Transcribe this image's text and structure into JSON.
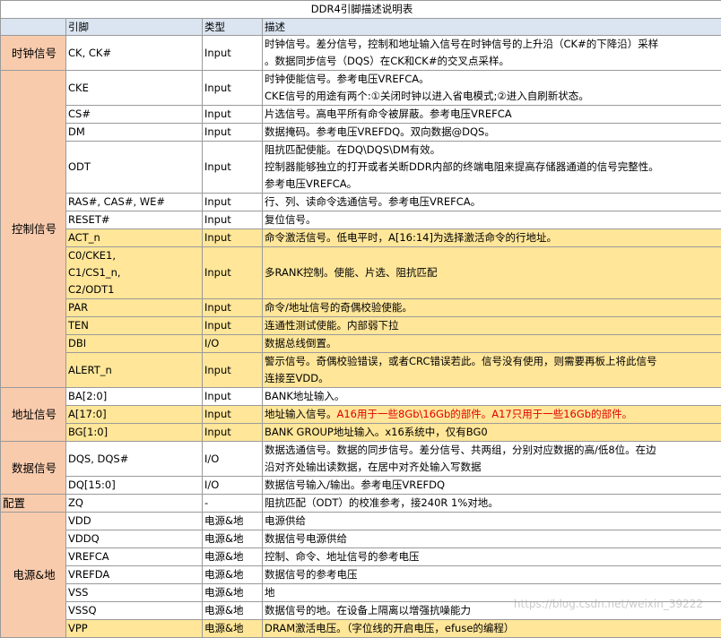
{
  "title": "DDR4引脚描述说明表",
  "headers": [
    "",
    "引脚",
    "类型",
    "描述"
  ],
  "groups": {
    "clock": "时钟信号",
    "control": "控制信号",
    "address": "地址信号",
    "data": "数据信号",
    "config": "配置",
    "power": "电源&地"
  },
  "rows": [
    {
      "pin": "CK, CK#",
      "type": "Input",
      "desc": [
        "时钟信号。差分信号，控制和地址输入信号在时钟信号的上升沿（CK#的下降沿）采样",
        "。数据同步信号（DQS）在CK和CK#的交叉点采样。"
      ]
    },
    {
      "pin": "CKE",
      "type": "Input",
      "desc": [
        "时钟使能信号。参考电压VREFCA。",
        "CKE信号的用途有两个:①关闭时钟以进入省电模式;②进入自刷新状态。"
      ]
    },
    {
      "pin": "CS#",
      "type": "Input",
      "desc": [
        "片选信号。高电平所有命令被屏蔽。参考电压VREFCA"
      ]
    },
    {
      "pin": "DM",
      "type": "Input",
      "desc": [
        "数据掩码。参考电压VREFDQ。双向数据@DQS。"
      ]
    },
    {
      "pin": "ODT",
      "type": "Input",
      "desc": [
        "阻抗匹配使能。在DQ\\DQS\\DM有效。",
        "控制器能够独立的打开或者关断DDR内部的终端电阻来提高存储器通道的信号完整性。",
        "参考电压VREFCA。"
      ]
    },
    {
      "pin": "RAS#, CAS#, WE#",
      "type": "Input",
      "desc": [
        "行、列、读命令选通信号。参考电压VREFCA。"
      ]
    },
    {
      "pin": "RESET#",
      "type": "Input",
      "desc": [
        "复位信号。"
      ]
    },
    {
      "pin": "ACT_n",
      "type": "Input",
      "desc": [
        "命令激活信号。低电平时，A[16:14]为选择激活命令的行地址。"
      ]
    },
    {
      "pin": [
        "C0/CKE1,",
        "C1/CS1_n,",
        "C2/ODT1"
      ],
      "type": "Input",
      "desc": [
        "多RANK控制。使能、片选、阻抗匹配"
      ]
    },
    {
      "pin": "PAR",
      "type": "Input",
      "desc": [
        "命令/地址信号的奇偶校验使能。"
      ]
    },
    {
      "pin": "TEN",
      "type": "Input",
      "desc": [
        "连通性测试使能。内部弱下拉"
      ]
    },
    {
      "pin": "DBI",
      "type": "I/O",
      "desc": [
        "数据总线倒置。"
      ]
    },
    {
      "pin": "ALERT_n",
      "type": "Input",
      "desc": [
        "警示信号。奇偶校验错误，或者CRC错误若此。信号没有使用，则需要再板上将此信号",
        "连接至VDD。"
      ]
    },
    {
      "pin": "BA[2:0]",
      "type": "Input",
      "desc": [
        "BANK地址输入。"
      ]
    },
    {
      "pin": "A[17:0]",
      "type": "Input",
      "desc": [
        "地址输入信号。"
      ],
      "desc_red": "A16用于一些8Gb\\16Gb的部件。A17只用于一些16Gb的部件。"
    },
    {
      "pin": "BG[1:0]",
      "type": "Input",
      "desc": [
        "BANK GROUP地址输入。x16系统中，仅有BG0"
      ]
    },
    {
      "pin": "DQS, DQS#",
      "type": "I/O",
      "desc": [
        "数据选通信号。数据的同步信号。差分信号、共两组，分别对应数据的高/低8位。在边",
        "沿对齐处输出读数据，在居中对齐处输入写数据"
      ]
    },
    {
      "pin": "DQ[15:0]",
      "type": "I/O",
      "desc": [
        "数据信号输入/输出。参考电压VREFDQ"
      ]
    },
    {
      "pin": "ZQ",
      "type": "-",
      "desc": [
        "阻抗匹配（ODT）的校准参考，接240R 1%对地。"
      ]
    },
    {
      "pin": "VDD",
      "type": "电源&地",
      "desc": [
        "电源供给"
      ]
    },
    {
      "pin": "VDDQ",
      "type": "电源&地",
      "desc": [
        "数据信号电源供给"
      ]
    },
    {
      "pin": "VREFCA",
      "type": "电源&地",
      "desc": [
        "控制、命令、地址信号的参考电压"
      ]
    },
    {
      "pin": "VREFDA",
      "type": "电源&地",
      "desc": [
        "数据信号的参考电压"
      ]
    },
    {
      "pin": "VSS",
      "type": "电源&地",
      "desc": [
        "地"
      ]
    },
    {
      "pin": "VSSQ",
      "type": "电源&地",
      "desc": [
        "数据信号的地。在设备上隔离以增强抗噪能力"
      ]
    },
    {
      "pin": "VPP",
      "type": "电源&地",
      "desc": [
        "DRAM激活电压。（字位线的开启电压，efuse的编程）"
      ]
    }
  ],
  "watermark": "https://blog.csdn.net/weixin_39222"
}
